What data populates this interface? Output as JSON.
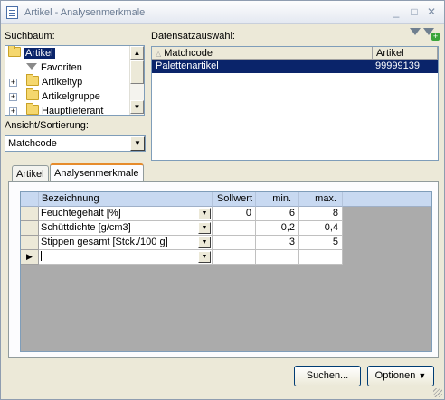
{
  "window": {
    "title": "Artikel - Analysenmerkmale",
    "minimize_icon": "minimize-icon",
    "maximize_icon": "maximize-icon",
    "close_icon": "close-icon"
  },
  "left": {
    "tree_label": "Suchbaum:",
    "tree_items": [
      {
        "label": "Artikel",
        "icon": "folder-icon",
        "selected": true
      },
      {
        "label": "Favoriten",
        "icon": "funnel-icon"
      },
      {
        "label": "Artikeltyp",
        "icon": "folder-icon",
        "expandable": true
      },
      {
        "label": "Artikelgruppe",
        "icon": "folder-icon",
        "expandable": true
      },
      {
        "label": "Hauptlieferant",
        "icon": "folder-icon",
        "expandable": true
      }
    ],
    "sort_label": "Ansicht/Sortierung:",
    "sort_value": "Matchcode"
  },
  "right": {
    "records_label": "Datensatzauswahl:",
    "columns": [
      "Matchcode",
      "Artikel"
    ],
    "rows": [
      {
        "matchcode": "Palettenartikel",
        "artikel": "99999139",
        "selected": true
      }
    ]
  },
  "tabs": [
    {
      "label": "Artikel",
      "active": false
    },
    {
      "label": "Analysenmerkmale",
      "active": true
    }
  ],
  "merkmale": {
    "columns": [
      "Bezeichnung",
      "Sollwert",
      "min.",
      "max."
    ],
    "rows": [
      {
        "bezeichnung": "Feuchtegehalt [%]",
        "sollwert": "0",
        "min": "6",
        "max": "8"
      },
      {
        "bezeichnung": "Schüttdichte [g/cm3]",
        "sollwert": "",
        "min": "0,2",
        "max": "0,4"
      },
      {
        "bezeichnung": "Stippen gesamt [Stck./100 g]",
        "sollwert": "",
        "min": "3",
        "max": "5"
      },
      {
        "bezeichnung": "",
        "sollwert": "",
        "min": "",
        "max": "",
        "new_row": true
      }
    ]
  },
  "buttons": {
    "search": "Suchen...",
    "options": "Optionen"
  }
}
